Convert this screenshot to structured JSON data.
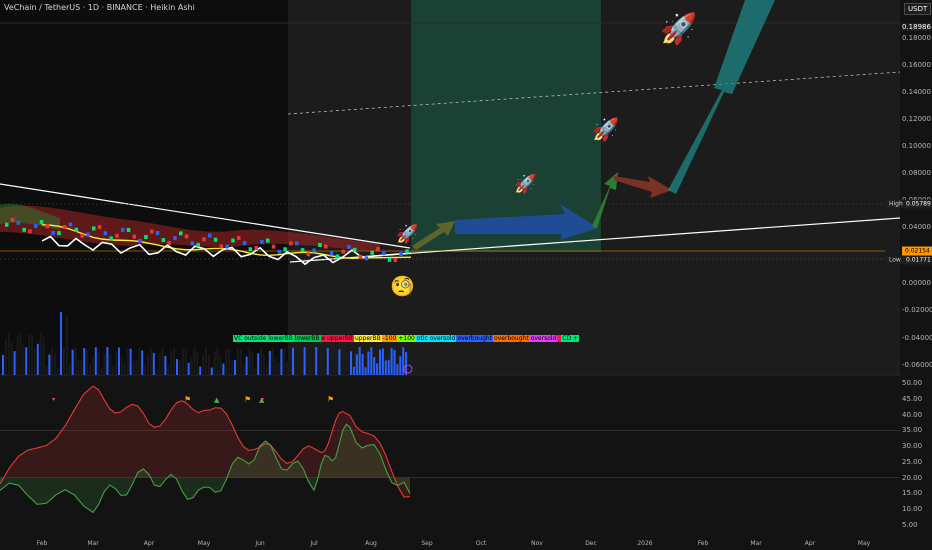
{
  "header": {
    "title": "VeChain / TetherUS · 1D · BINANCE · Heikin Ashi",
    "currency": "USDT"
  },
  "price_axis": {
    "ticks": [
      "0.18986",
      "0.18000",
      "0.16000",
      "0.14000",
      "0.12000",
      "0.10000",
      "0.08000",
      "0.06000",
      "0.04000",
      "0.02000",
      "0.00000",
      "-0.02000",
      "-0.04000",
      "-0.06000"
    ],
    "high_label": "High",
    "high_value": "0.05789",
    "low_label": "Low",
    "low_value": "0.01771",
    "last_value": "0.02154"
  },
  "osc_axis": {
    "ticks": [
      "50.00",
      "45.00",
      "40.00",
      "35.00",
      "30.00",
      "25.00",
      "20.00",
      "15.00",
      "10.00",
      "5.00"
    ]
  },
  "time_axis": {
    "labels": [
      "Feb",
      "Mar",
      "Apr",
      "May",
      "Jun",
      "Jul",
      "Aug",
      "Sep",
      "Oct",
      "Nov",
      "Dec",
      "2026",
      "Feb",
      "Mar",
      "Apr",
      "May"
    ]
  },
  "legend": {
    "items": [
      {
        "text": "VC outside lowerBB",
        "color": "#00e676"
      },
      {
        "text": "lowerBB",
        "color": "#00c853"
      },
      {
        "text": "e upperBB",
        "color": "#ff1744"
      },
      {
        "text": "upperBB",
        "color": "#ffeb3b"
      },
      {
        "text": "-100",
        "color": "#ff9800"
      },
      {
        "text": "+100",
        "color": "#76ff03"
      },
      {
        "text": "otic oversold",
        "color": "#00e5ff"
      },
      {
        "text": "overbought",
        "color": "#2962ff"
      },
      {
        "text": "overbought",
        "color": "#ff6d00"
      },
      {
        "text": "oversold",
        "color": "#e040fb"
      },
      {
        "text": "",
        "color": "#ff1744"
      },
      {
        "text": "CD +",
        "color": "#00e676"
      }
    ]
  },
  "colors": {
    "projection_zone": "#1b4d3e",
    "up": "#4caf50",
    "down": "#ef5350",
    "volume": "#2962ff"
  },
  "icons": [
    "rocket-icon",
    "rocket-icon",
    "rocket-icon",
    "rocket-icon",
    "rocket-icon",
    "thinking-face-icon"
  ],
  "chart_data": [
    {
      "type": "line",
      "pane": "price",
      "title": "VeChain / TetherUS · 1D · BINANCE · Heikin Ashi",
      "x_months": [
        "Feb",
        "Mar",
        "Apr",
        "May",
        "Jun",
        "Jul",
        "Aug"
      ],
      "series": [
        {
          "values": [
            0.046,
            0.038,
            0.031,
            0.028,
            0.025,
            0.024,
            0.022
          ]
        },
        {
          "values": [
            0.034,
            0.031,
            0.027,
            0.027,
            0.025,
            0.02,
            0.025
          ]
        }
      ],
      "high": 0.05789,
      "low": 0.01771,
      "last": 0.02154,
      "ylim": [
        -0.065,
        0.195
      ]
    },
    {
      "type": "line",
      "pane": "oscillator",
      "x_months": [
        "Feb",
        "Mar",
        "Apr",
        "May",
        "Jun",
        "Jul",
        "Aug"
      ],
      "series": [
        {
          "values": [
            18,
            47,
            38,
            44,
            28,
            27,
            42,
            14
          ]
        },
        {
          "values": [
            16,
            12,
            21,
            14,
            30,
            19,
            36,
            15
          ]
        }
      ],
      "ylim": [
        3,
        52
      ]
    }
  ]
}
